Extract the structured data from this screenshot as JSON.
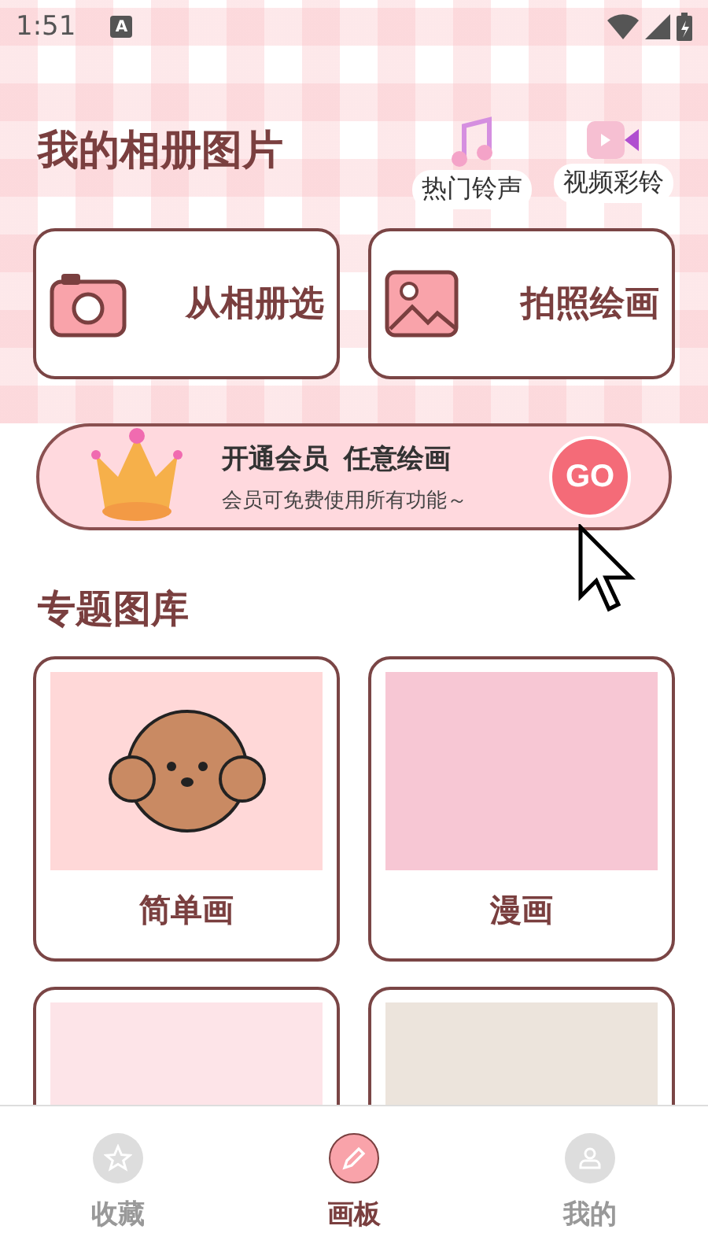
{
  "status_bar": {
    "time": "1:51",
    "badge": "A"
  },
  "header": {
    "title": "我的相册图片",
    "shortcuts": [
      {
        "kind": "music",
        "label": "热门铃声"
      },
      {
        "kind": "video",
        "label": "视频彩铃"
      }
    ]
  },
  "actions": [
    {
      "kind": "camera",
      "label": "从相册选"
    },
    {
      "kind": "image",
      "label": "拍照绘画"
    }
  ],
  "banner": {
    "title": "开通会员  任意绘画",
    "subtitle": "会员可免费使用所有功能～",
    "button": "GO"
  },
  "section_title": "专题图库",
  "gallery": [
    {
      "kind": "dog",
      "label": "简单画"
    },
    {
      "kind": "anime",
      "label": "漫画"
    },
    {
      "kind": "panda"
    },
    {
      "kind": "sketch"
    }
  ],
  "tabs": [
    {
      "kind": "star",
      "label": "收藏",
      "selected": false
    },
    {
      "kind": "pencil",
      "label": "画板",
      "selected": true
    },
    {
      "kind": "person",
      "label": "我的",
      "selected": false
    }
  ]
}
